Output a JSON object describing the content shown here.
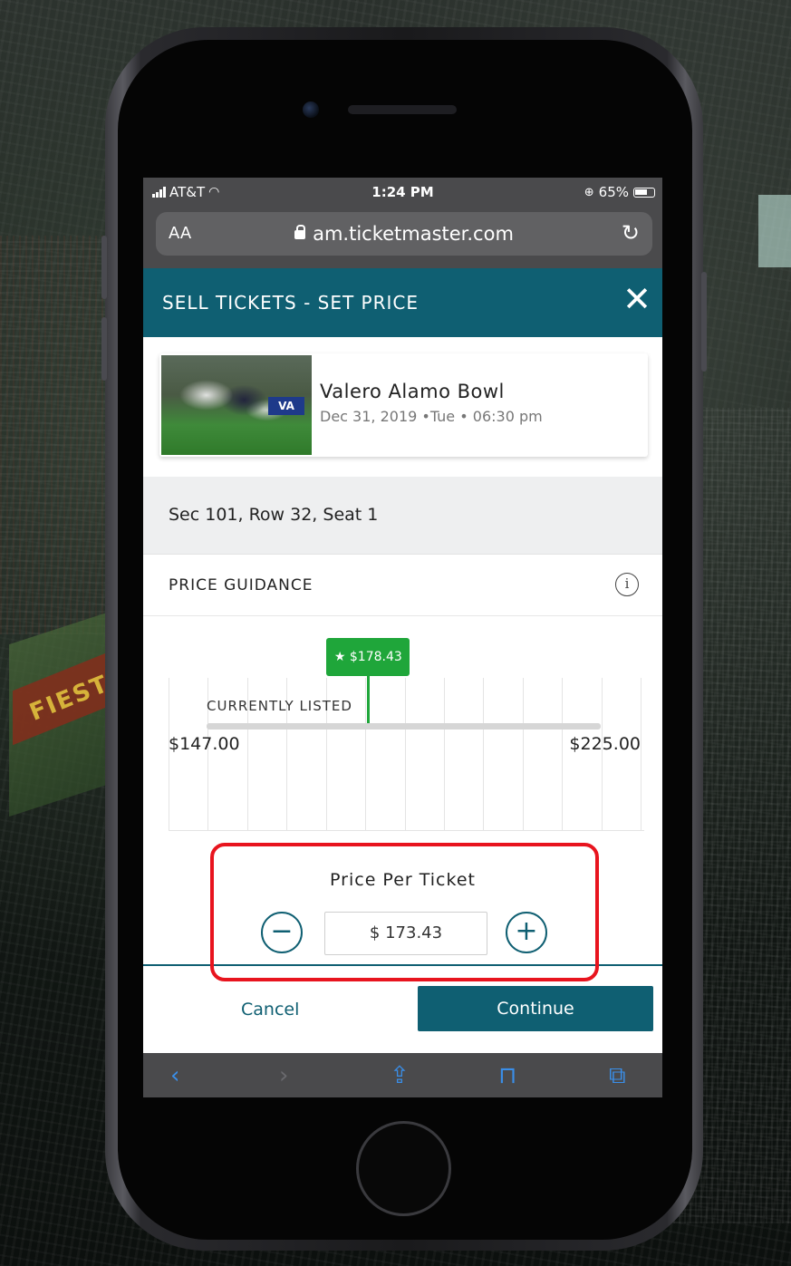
{
  "status_bar": {
    "carrier": "AT&T",
    "time": "1:24 PM",
    "battery": "65%"
  },
  "browser": {
    "text_size_label": "AA",
    "url": "am.ticketmaster.com"
  },
  "header": {
    "title": "SELL TICKETS - SET PRICE"
  },
  "event": {
    "name": "Valero Alamo Bowl",
    "date": "Dec 31, 2019 •Tue • 06:30 pm",
    "image_sign": "VA"
  },
  "seat": {
    "label": "Sec 101, Row 32, Seat 1"
  },
  "price_guidance": {
    "title": "PRICE GUIDANCE",
    "recommended_price": "$178.43",
    "recommended_position": 0.41,
    "current_listing_position": 0.41,
    "currently_listed_label": "CURRENTLY LISTED",
    "range_min": "$147.00",
    "range_max": "$225.00"
  },
  "price_per_ticket": {
    "label": "Price Per Ticket",
    "value": "$ 173.43"
  },
  "actions": {
    "cancel": "Cancel",
    "continue": "Continue"
  },
  "colors": {
    "brand": "#0f5f72",
    "recommend": "#1fa63a",
    "highlight": "#e8141e"
  },
  "background_text": "FIESTA"
}
